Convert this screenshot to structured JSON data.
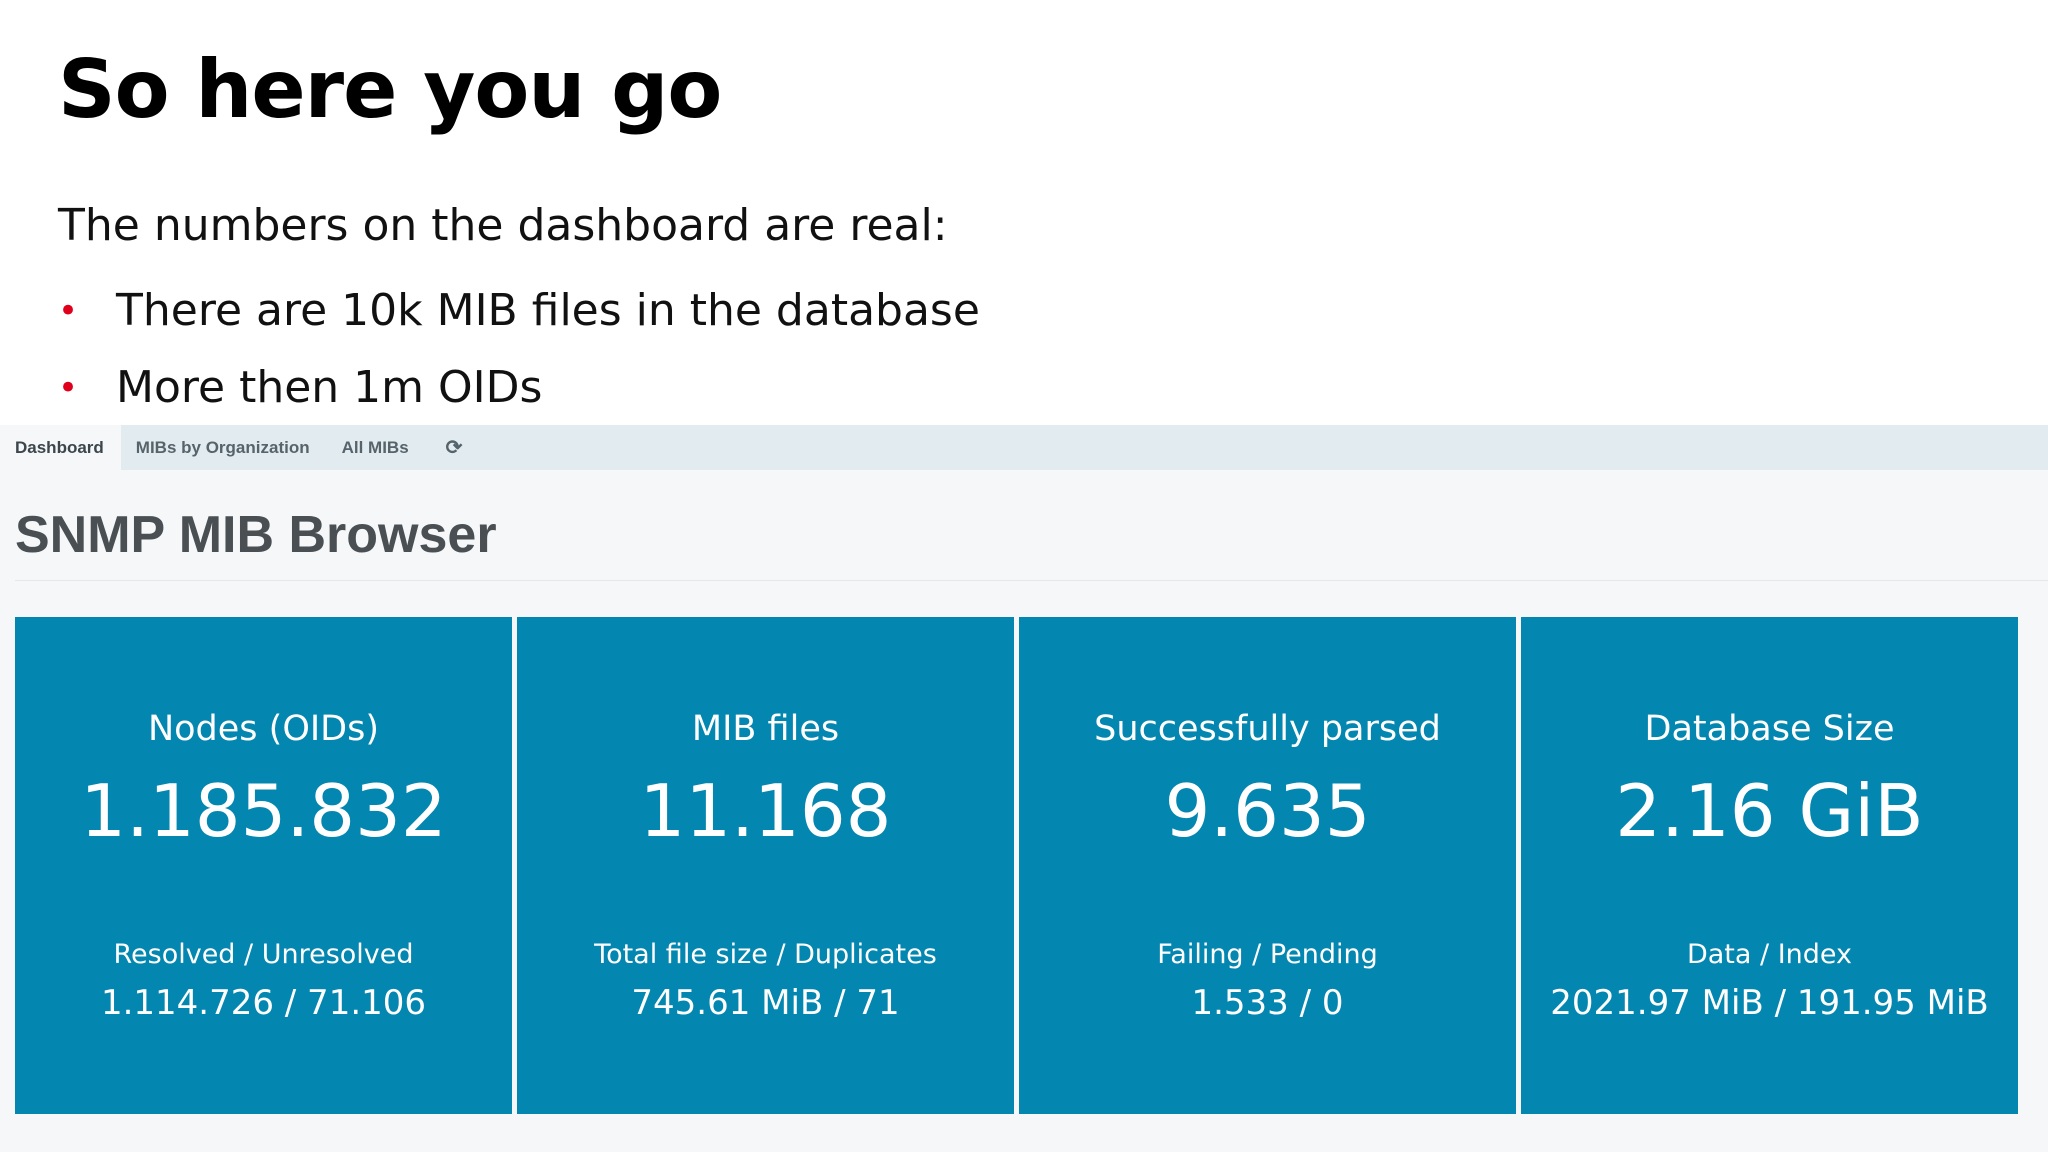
{
  "slide": {
    "title": "So here you go",
    "intro": "The numbers on the dashboard are real:",
    "bullets": [
      "There are 10k MIB files in the database",
      "More then 1m OIDs"
    ],
    "bullet_glyph": "•",
    "bullet_color": "#e0001b"
  },
  "app": {
    "tabs": [
      {
        "label": "Dashboard",
        "active": true
      },
      {
        "label": "MIBs by Organization",
        "active": false
      },
      {
        "label": "All MIBs",
        "active": false
      }
    ],
    "refresh_icon": "refresh-icon",
    "refresh_glyph": "⟳",
    "title": "SNMP MIB Browser",
    "accent_color": "#0386b0",
    "cards": [
      {
        "label": "Nodes (OIDs)",
        "value": "1.185.832",
        "sub_label": "Resolved / Unresolved",
        "sub_value": "1.114.726 / 71.106"
      },
      {
        "label": "MIB files",
        "value": "11.168",
        "sub_label": "Total file size / Duplicates",
        "sub_value": "745.61 MiB / 71"
      },
      {
        "label": "Successfully parsed",
        "value": "9.635",
        "sub_label": "Failing / Pending",
        "sub_value": "1.533 / 0"
      },
      {
        "label": "Database Size",
        "value": "2.16 GiB",
        "sub_label": "Data / Index",
        "sub_value": "2021.97 MiB / 191.95 MiB"
      }
    ]
  }
}
